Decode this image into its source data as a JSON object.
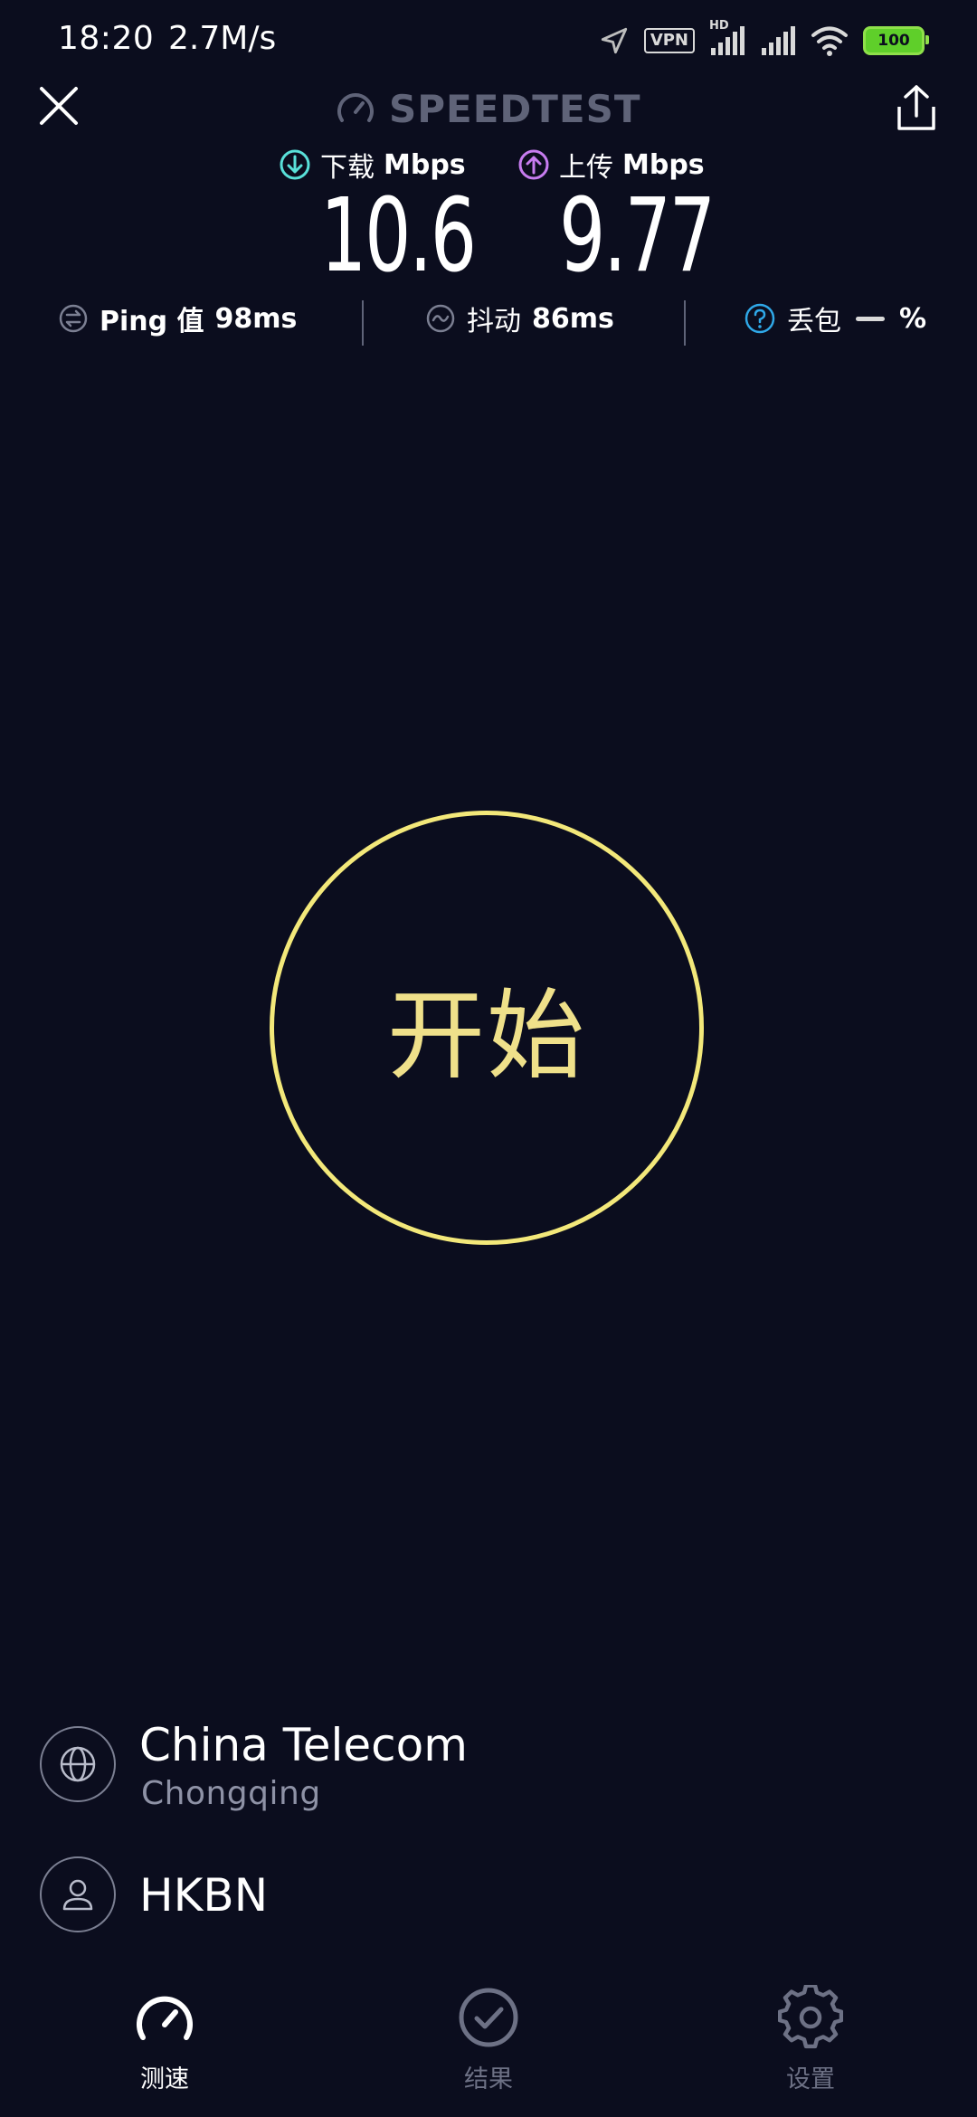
{
  "status_bar": {
    "time": "18:20",
    "network_speed": "2.7M/s",
    "vpn_label": "VPN",
    "hd_label": "HD",
    "battery": "100"
  },
  "header": {
    "brand": "SPEEDTEST"
  },
  "speeds": {
    "download_label": "下载",
    "download_unit": "Mbps",
    "download_value": "10.6",
    "upload_label": "上传",
    "upload_unit": "Mbps",
    "upload_value": "9.77"
  },
  "metrics": {
    "ping_label": "Ping 值",
    "ping_value": "98ms",
    "jitter_label": "抖动",
    "jitter_value": "86ms",
    "loss_label": "丢包",
    "loss_unit": "%"
  },
  "start_button": {
    "label": "开始"
  },
  "provider": {
    "isp_name": "China Telecom",
    "isp_location": "Chongqing",
    "host_name": "HKBN"
  },
  "nav": {
    "speed_label": "测速",
    "results_label": "结果",
    "settings_label": "设置"
  },
  "colors": {
    "background": "#0b0d1e",
    "accent_yellow": "#f3e87a",
    "download_cyan": "#59e0d9",
    "upload_purple": "#c77cf0",
    "battery_green": "#5fcf2a"
  }
}
